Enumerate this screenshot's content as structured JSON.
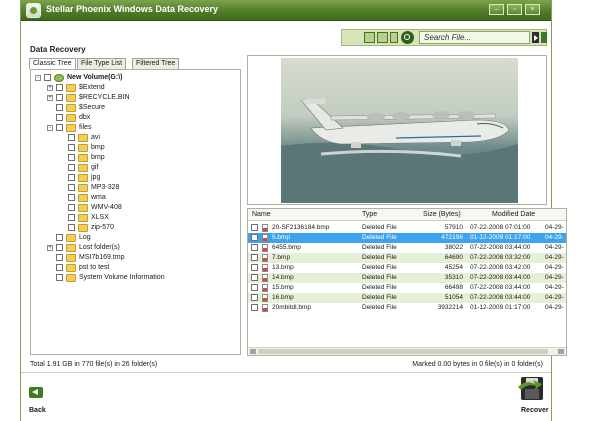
{
  "window": {
    "title": "Stellar Phoenix Windows Data Recovery"
  },
  "section_title": "Data Recovery",
  "search": {
    "placeholder": "Search File..."
  },
  "tabs": [
    "Classic Tree",
    "File Type List",
    "Filtered Tree"
  ],
  "tree": [
    {
      "label": "New Volume(G:\\)",
      "level": 0,
      "expand": "-",
      "kind": "drive"
    },
    {
      "label": "$Extend",
      "level": 1,
      "expand": "+"
    },
    {
      "label": "$RECYCLE.BIN",
      "level": 1,
      "expand": "+"
    },
    {
      "label": "$Secure",
      "level": 1,
      "expand": ""
    },
    {
      "label": "dbx",
      "level": 1,
      "expand": ""
    },
    {
      "label": "files",
      "level": 1,
      "expand": "-"
    },
    {
      "label": "avi",
      "level": 2,
      "expand": ""
    },
    {
      "label": "bmp",
      "level": 2,
      "expand": ""
    },
    {
      "label": "bmp",
      "level": 2,
      "expand": ""
    },
    {
      "label": "gif",
      "level": 2,
      "expand": ""
    },
    {
      "label": "jpg",
      "level": 2,
      "expand": ""
    },
    {
      "label": "MP3-328",
      "level": 2,
      "expand": ""
    },
    {
      "label": "wma",
      "level": 2,
      "expand": ""
    },
    {
      "label": "WMV-408",
      "level": 2,
      "expand": ""
    },
    {
      "label": "XLSX",
      "level": 2,
      "expand": ""
    },
    {
      "label": "zip-570",
      "level": 2,
      "expand": ""
    },
    {
      "label": "Log",
      "level": 1,
      "expand": ""
    },
    {
      "label": "Lost folder(s)",
      "level": 1,
      "expand": "+"
    },
    {
      "label": "MSI7b169.tmp",
      "level": 1,
      "expand": ""
    },
    {
      "label": "pst to test",
      "level": 1,
      "expand": ""
    },
    {
      "label": "System Volume Information",
      "level": 1,
      "expand": ""
    }
  ],
  "file_list": {
    "columns": [
      "Name",
      "Type",
      "Size (Bytes)",
      "Modified Date"
    ],
    "rows": [
      {
        "name": "20-SF2136184.bmp",
        "type": "Deleted File",
        "size": "57910",
        "date": "07-22-2008 07:01:00",
        "extra": "04-29-",
        "state": "normal"
      },
      {
        "name": "5.bmp",
        "type": "Deleted File",
        "size": "472196",
        "date": "01-12-2009 01:17:00",
        "extra": "04-29-",
        "state": "selected"
      },
      {
        "name": "6455.bmp",
        "type": "Deleted File",
        "size": "38022",
        "date": "07-22-2008 03:44:00",
        "extra": "04-29-",
        "state": "normal"
      },
      {
        "name": "7.bmp",
        "type": "Deleted File",
        "size": "64690",
        "date": "07-22-2008 03:32:00",
        "extra": "04-29-",
        "state": "alt"
      },
      {
        "name": "13.bmp",
        "type": "Deleted File",
        "size": "45254",
        "date": "07-22-2008 03:42:00",
        "extra": "04-29-",
        "state": "normal"
      },
      {
        "name": "14.bmp",
        "type": "Deleted File",
        "size": "35310",
        "date": "07-22-2008 03:44:00",
        "extra": "04-29-",
        "state": "alt"
      },
      {
        "name": "15.bmp",
        "type": "Deleted File",
        "size": "66498",
        "date": "07-22-2008 03:44:00",
        "extra": "04-29-",
        "state": "normal"
      },
      {
        "name": "16.bmp",
        "type": "Deleted File",
        "size": "51054",
        "date": "07-22-2008 03:44:00",
        "extra": "04-29-",
        "state": "alt"
      },
      {
        "name": "20mbitdl.bmp",
        "type": "Deleted File",
        "size": "3932214",
        "date": "01-12-2009 01:17:00",
        "extra": "04-29-",
        "state": "normal"
      }
    ]
  },
  "status": {
    "left": "Total 1.91 GB in 770 file(s) in 26 folder(s)",
    "right": "Marked 0.00 bytes in 0 file(s) in 0 folder(s)"
  },
  "bottom": {
    "back_label": "Back",
    "recover_label": "Recover"
  },
  "colors": {
    "titlebar": "#4f7a26",
    "selection": "#3da3ee",
    "alt_row": "#e6f0d6",
    "toolbar": "#d6e4b7"
  }
}
